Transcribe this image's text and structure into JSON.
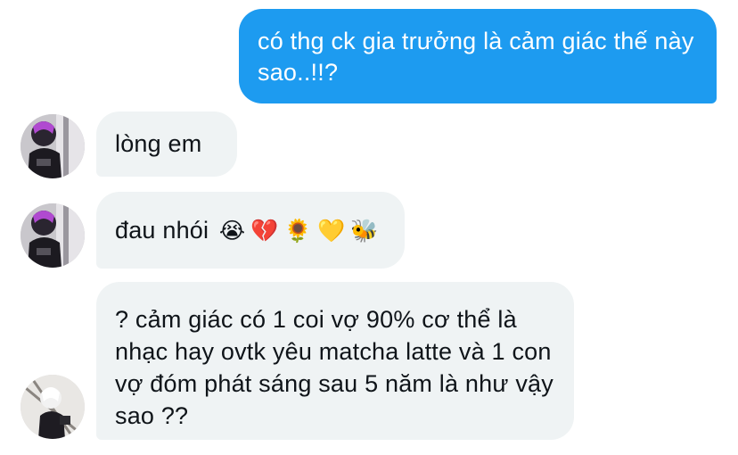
{
  "conversation": {
    "messages": [
      {
        "direction": "sent",
        "text": "có thg ck gia trưởng là cảm giác thế này sao..!!?"
      },
      {
        "direction": "received",
        "text": "lòng em"
      },
      {
        "direction": "received",
        "text": "đau nhói",
        "emojis": [
          "😭",
          "💔",
          "🌻",
          "💛",
          "🐝"
        ]
      },
      {
        "direction": "received",
        "text": "? cảm giác có 1 coi vợ 90% cơ thể là nhạc hay ovtk yêu matcha latte và 1 con vợ đóm phát sáng sau 5 năm là như vậy sao ??"
      }
    ]
  },
  "colors": {
    "sent_bubble": "#1d9bf0",
    "received_bubble": "#eff3f4",
    "background": "#ffffff",
    "sent_text": "#ffffff",
    "received_text": "#0f1419"
  }
}
